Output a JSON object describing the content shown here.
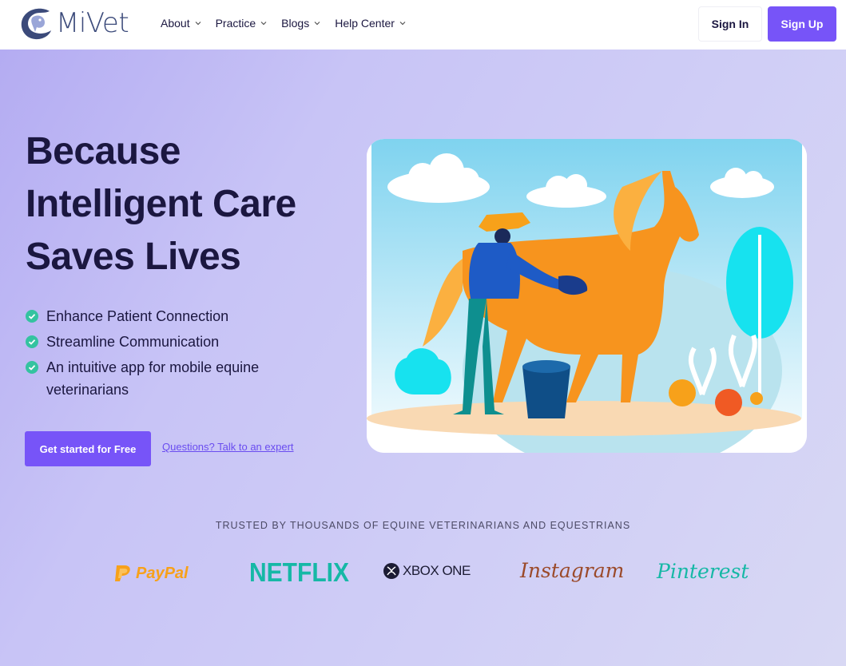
{
  "brand": {
    "name": "MiVet",
    "accent": "#7754f8"
  },
  "nav": {
    "items": [
      {
        "label": "About"
      },
      {
        "label": "Practice"
      },
      {
        "label": "Blogs"
      },
      {
        "label": "Help Center"
      }
    ],
    "signin_label": "Sign In",
    "signup_label": "Sign Up"
  },
  "hero": {
    "headline": "Because Intelligent Care Saves Lives",
    "features": [
      "Enhance Patient Connection",
      "Streamline Communication",
      "An intuitive app for mobile equine veterinarians"
    ],
    "cta_label": "Get started for Free",
    "expert_link": "Questions? Talk to an expert",
    "check_color": "#34c3a0"
  },
  "trusted": {
    "heading": "TRUSTED BY THOUSANDS OF EQUINE VETERINARIANS AND EQUESTRIANS",
    "logos": [
      "PayPal",
      "NETFLIX",
      "XBOX ONE",
      "Instagram",
      "Pinterest"
    ]
  },
  "icons": {
    "logo": "horse-head-logo-icon",
    "chevron": "chevron-down-icon",
    "check": "check-circle-icon",
    "illustration": "vet-grooming-horse-illustration"
  }
}
